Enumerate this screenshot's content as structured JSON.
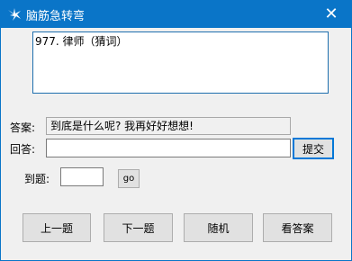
{
  "window": {
    "title": "脑筋急转弯",
    "close_glyph": "✕"
  },
  "question": {
    "text": "977. 律师（猜词）"
  },
  "answer": {
    "label": "答案:",
    "text": "到底是什么呢? 我再好好想想!"
  },
  "reply": {
    "label": "回答:",
    "value": "",
    "submit_label": "提交"
  },
  "goto": {
    "label": "到题:",
    "value": "",
    "go_label": "go"
  },
  "nav": {
    "prev_label": "上一题",
    "next_label": "下一题",
    "random_label": "随机",
    "show_answer_label": "看答案"
  }
}
